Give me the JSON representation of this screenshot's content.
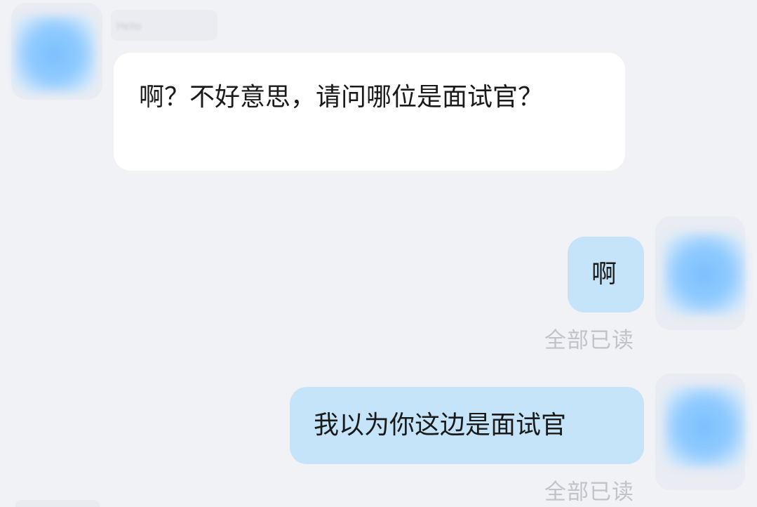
{
  "messages": [
    {
      "direction": "incoming",
      "sender_name": "Hello",
      "text": "啊？不好意思，请问哪位是面试官？"
    },
    {
      "direction": "outgoing",
      "text": "啊",
      "status": "全部已读"
    },
    {
      "direction": "outgoing",
      "text": "我以为你这边是面试官",
      "status": "全部已读"
    }
  ],
  "colors": {
    "background": "#f1f2f6",
    "incoming_bubble": "#ffffff",
    "outgoing_bubble": "#c5e4fa",
    "read_status": "#c0c3ca",
    "avatar": "#8fcaff"
  }
}
